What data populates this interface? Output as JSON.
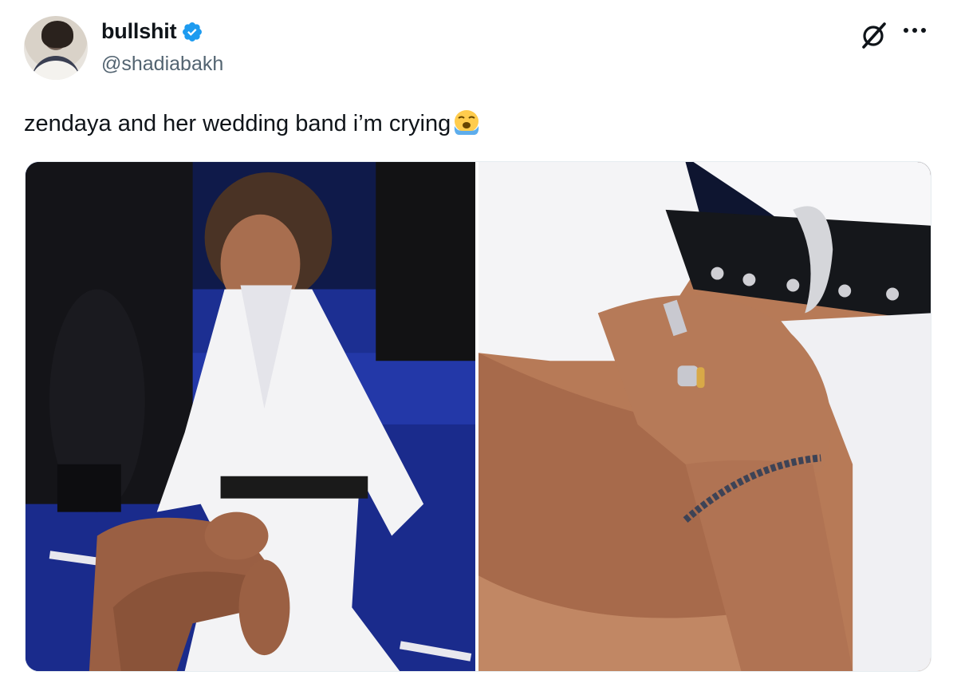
{
  "tweet": {
    "author": {
      "display_name": "bullshit",
      "verified": true,
      "handle": "@shadiabakh"
    },
    "text": "zendaya and her wedding band i’m crying",
    "emoji": "loudly-crying-face",
    "media": [
      {
        "name": "photo-left"
      },
      {
        "name": "photo-right"
      }
    ]
  },
  "icons": {
    "verified": "verified-badge-icon",
    "grok": "grok-icon",
    "more": "more-icon"
  },
  "colors": {
    "verified_blue": "#1d9bf0",
    "handle_gray": "#536471",
    "text": "#0f1419"
  }
}
